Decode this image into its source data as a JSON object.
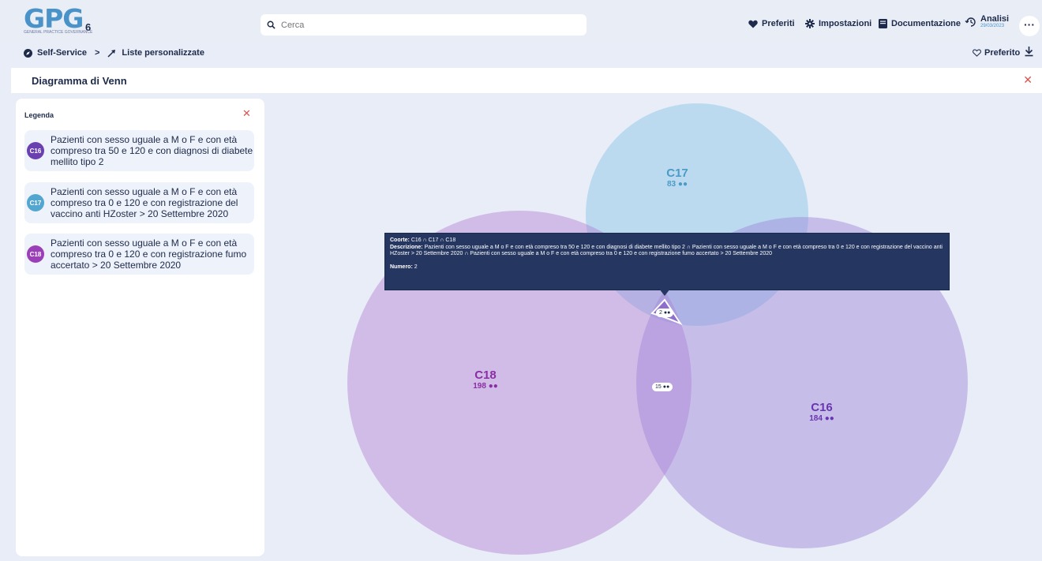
{
  "app": {
    "logo_text": "GPG",
    "logo_version": "6",
    "logo_subtitle": "GENERAL PRACTICE GOVERNANCE"
  },
  "search": {
    "placeholder": "Cerca",
    "value": ""
  },
  "nav": {
    "preferiti": "Preferiti",
    "impostazioni": "Impostazioni",
    "documentazione": "Documentazione",
    "analisi": "Analisi",
    "analisi_date": "29/03/2023"
  },
  "breadcrumb": {
    "item1": "Self-Service",
    "separator": ">",
    "item2": "Liste personalizzate"
  },
  "actions": {
    "preferito": "Preferito"
  },
  "panel": {
    "title": "Diagramma di Venn"
  },
  "legend": {
    "title": "Legenda",
    "items": [
      {
        "code": "C16",
        "color": "#6a3fb0",
        "text": "Pazienti con sesso uguale a M o F e con età compreso tra 50 e 120 e con diagnosi di diabete mellito tipo 2"
      },
      {
        "code": "C17",
        "color": "#52a6cf",
        "text": "Pazienti con sesso uguale a M o F e con età compreso tra 0 e 120 e con registrazione del vaccino anti HZoster > 20 Settembre 2020"
      },
      {
        "code": "C18",
        "color": "#9b3fb8",
        "text": "Pazienti con sesso uguale a M o F e con età compreso tra 0 e 120 e con registrazione fumo accertato > 20 Settembre 2020"
      }
    ]
  },
  "venn": {
    "sets": [
      {
        "id": "C17",
        "count": "83",
        "color": "#4a9bc6"
      },
      {
        "id": "C18",
        "count": "198",
        "color": "#8a2fa3"
      },
      {
        "id": "C16",
        "count": "184",
        "color": "#6a35b0"
      }
    ],
    "intersections": [
      {
        "sets": "C16 ∩ C17 ∩ C18",
        "count": "2"
      },
      {
        "sets": "C16 ∩ C18",
        "count": "15"
      }
    ]
  },
  "tooltip": {
    "coorte_label": "Coorte:",
    "coorte_value": "C16 ∩ C17 ∩ C18",
    "descrizione_label": "Descrizione:",
    "descrizione_value": "Pazienti con sesso uguale a M o F e con età compreso tra 50 e 120 e con diagnosi di diabete mellito tipo 2 ∩ Pazienti con sesso uguale a M o F e con età compreso tra 0 e 120 e con registrazione del vaccino anti HZoster > 20 Settembre 2020 ∩ Pazienti con sesso uguale a M o F e con età compreso tra 0 e 120 e con registrazione fumo accertato > 20 Settembre 2020",
    "numero_label": "Numero:",
    "numero_value": "2"
  }
}
